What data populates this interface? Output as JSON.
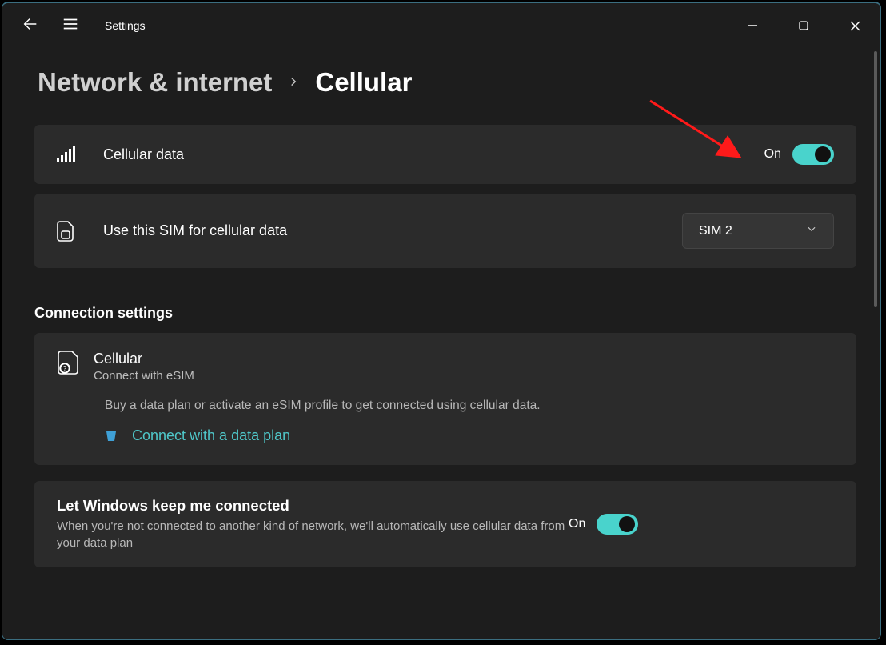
{
  "titlebar": {
    "app_name": "Settings"
  },
  "breadcrumb": {
    "parent": "Network & internet",
    "current": "Cellular"
  },
  "cellular_data": {
    "label": "Cellular data",
    "state_label": "On"
  },
  "sim_select": {
    "label": "Use this SIM for cellular data",
    "value": "SIM 2"
  },
  "connection_section": {
    "heading": "Connection settings"
  },
  "esim_card": {
    "title": "Cellular",
    "subtitle": "Connect with eSIM",
    "description": "Buy a data plan or activate an eSIM profile to get connected using cellular data.",
    "link_label": "Connect with a data plan"
  },
  "keep_connected": {
    "title": "Let Windows keep me connected",
    "description": "When you're not connected to another kind of network, we'll automatically use cellular data from your data plan",
    "state_label": "On"
  }
}
